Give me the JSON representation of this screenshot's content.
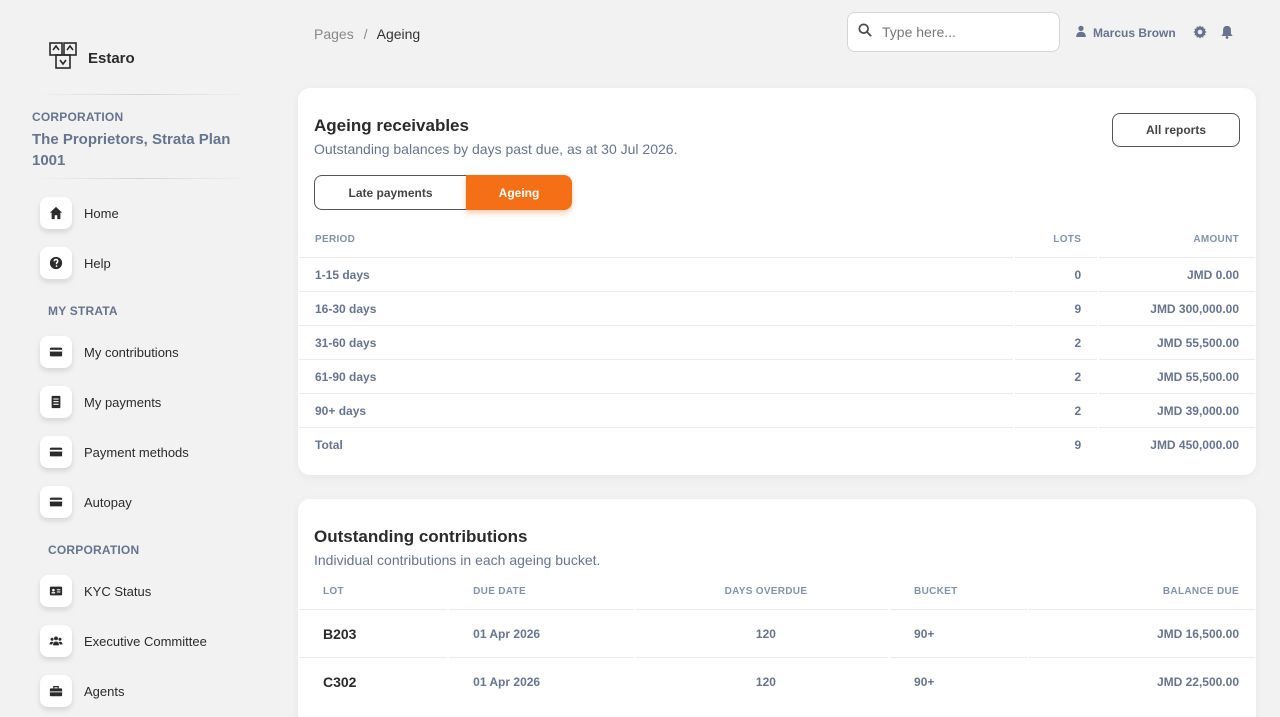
{
  "brand": {
    "name": "Estaro"
  },
  "sidebar": {
    "corporation_label": "CORPORATION",
    "corporation_name": "The Proprietors, Strata Plan 1001",
    "items_top": [
      {
        "label": "Home",
        "icon": "home-icon"
      },
      {
        "label": "Help",
        "icon": "help-icon"
      }
    ],
    "section_my_strata": "MY STRATA",
    "items_my_strata": [
      {
        "label": "My contributions",
        "icon": "credit-card-icon"
      },
      {
        "label": "My payments",
        "icon": "receipt-icon"
      },
      {
        "label": "Payment methods",
        "icon": "credit-card-icon"
      },
      {
        "label": "Autopay",
        "icon": "credit-card-icon"
      }
    ],
    "section_corporation": "CORPORATION",
    "items_corporation": [
      {
        "label": "KYC Status",
        "icon": "id-card-icon"
      },
      {
        "label": "Executive Committee",
        "icon": "users-icon"
      },
      {
        "label": "Agents",
        "icon": "briefcase-icon"
      }
    ]
  },
  "breadcrumb": {
    "root": "Pages",
    "separator": "/",
    "current": "Ageing"
  },
  "search": {
    "placeholder": "Type here..."
  },
  "user": {
    "name": "Marcus Brown"
  },
  "ageing_card": {
    "title": "Ageing receivables",
    "subtitle": "Outstanding balances by days past due, as at 30 Jul 2026.",
    "all_reports_label": "All reports",
    "tabs": [
      {
        "label": "Late payments",
        "active": false
      },
      {
        "label": "Ageing",
        "active": true
      }
    ],
    "columns": [
      "PERIOD",
      "LOTS",
      "AMOUNT"
    ],
    "rows": [
      {
        "period": "1-15 days",
        "lots": "0",
        "amount": "JMD 0.00"
      },
      {
        "period": "16-30 days",
        "lots": "9",
        "amount": "JMD 300,000.00"
      },
      {
        "period": "31-60 days",
        "lots": "2",
        "amount": "JMD 55,500.00"
      },
      {
        "period": "61-90 days",
        "lots": "2",
        "amount": "JMD 55,500.00"
      },
      {
        "period": "90+ days",
        "lots": "2",
        "amount": "JMD 39,000.00"
      },
      {
        "period": "Total",
        "lots": "9",
        "amount": "JMD 450,000.00"
      }
    ]
  },
  "contrib_card": {
    "title": "Outstanding contributions",
    "subtitle": "Individual contributions in each ageing bucket.",
    "columns": [
      "LOT",
      "DUE DATE",
      "DAYS OVERDUE",
      "BUCKET",
      "BALANCE DUE"
    ],
    "rows": [
      {
        "lot": "B203",
        "due_date": "01 Apr 2026",
        "days_overdue": "120",
        "bucket": "90+",
        "balance_due": "JMD 16,500.00"
      },
      {
        "lot": "C302",
        "due_date": "01 Apr 2026",
        "days_overdue": "120",
        "bucket": "90+",
        "balance_due": "JMD 22,500.00"
      }
    ]
  },
  "colors": {
    "accent": "#f56f16",
    "muted": "#67748e",
    "background": "#f2f2f2"
  }
}
